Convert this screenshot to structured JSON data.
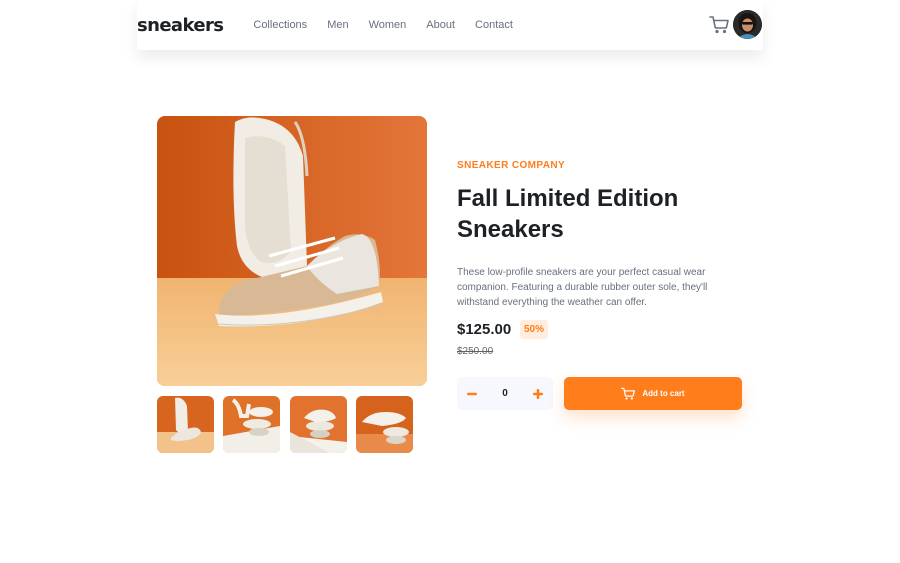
{
  "header": {
    "logo": "sneakers",
    "nav": [
      "Collections",
      "Men",
      "Women",
      "About",
      "Contact"
    ]
  },
  "product": {
    "company": "SNEAKER COMPANY",
    "title": "Fall Limited Edition Sneakers",
    "description": "These low-profile sneakers are your perfect casual wear companion. Featuring a durable rubber outer sole, they'll withstand everything the weather can offer.",
    "price": "$125.00",
    "discount": "50%",
    "old_price": "$250.00",
    "quantity": "0",
    "add_to_cart_label": "Add to cart"
  },
  "colors": {
    "accent": "#ff7d1a",
    "accent_pale": "#ffede0",
    "text_dark": "#1d2025",
    "text_muted": "#68707d",
    "qty_bg": "#f6f8fd"
  },
  "icons": {
    "cart": "cart-icon",
    "minus": "minus-icon",
    "plus": "plus-icon"
  }
}
